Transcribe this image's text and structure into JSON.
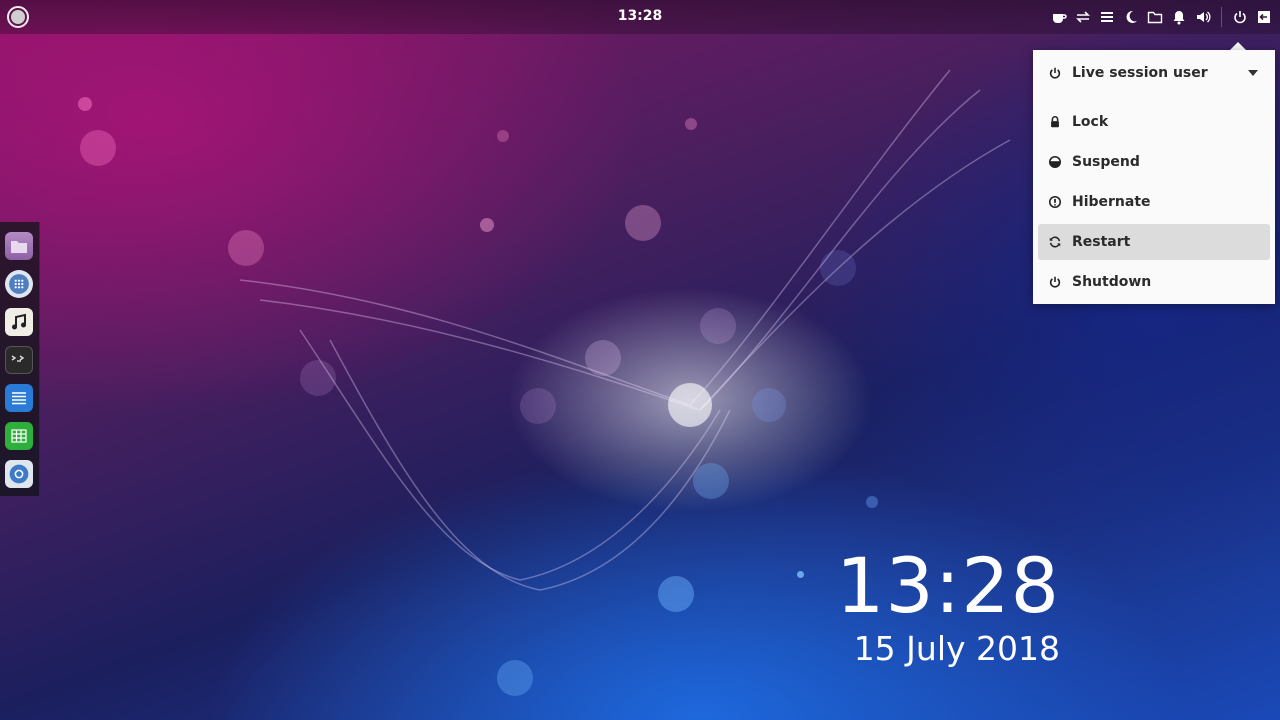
{
  "topbar": {
    "clock": "13:28",
    "tray_icons": [
      "coffee-icon",
      "transfer-icon",
      "menu-icon",
      "moon-icon",
      "folder-icon",
      "bell-icon",
      "volume-icon",
      "power-icon",
      "logout-icon"
    ]
  },
  "dock": {
    "apps": [
      "files-icon",
      "app-grid-icon",
      "music-icon",
      "terminal-icon",
      "text-editor-icon",
      "spreadsheet-icon",
      "browser-icon"
    ]
  },
  "power_menu": {
    "user_label": "Live session user",
    "items": [
      {
        "label": "Lock",
        "icon": "lock-icon"
      },
      {
        "label": "Suspend",
        "icon": "suspend-icon"
      },
      {
        "label": "Hibernate",
        "icon": "hibernate-icon"
      },
      {
        "label": "Restart",
        "icon": "restart-icon",
        "highlighted": true
      },
      {
        "label": "Shutdown",
        "icon": "power-icon"
      }
    ]
  },
  "desktop_clock": {
    "time": "13:28",
    "date": "15 July 2018"
  },
  "colors": {
    "menu_bg": "#fafafa",
    "menu_highlight": "#dcdcdc",
    "dock_bg": "#14141c"
  }
}
